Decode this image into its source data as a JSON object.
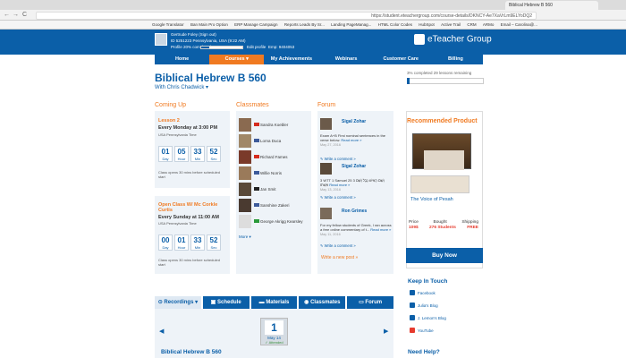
{
  "browser": {
    "tab_title": "Biblical Hebrew B 560",
    "url": "https://student.eteachergroup.com/course-details/DKNCY-Ae7XaVrLm9ELYoDQ2",
    "nav_back": "←",
    "nav_forward": "→",
    "nav_reload": "C",
    "bookmarks": [
      "Google Translator",
      "Ban Main Pro Option",
      "ERP Manage Campaign",
      "Reports Leads By Sr...",
      "Landing PageManag...",
      "HTML Color Codes",
      "HubSpot",
      "Active Trail",
      "CRM",
      "ARMo",
      "Email – Carolina@..."
    ]
  },
  "user": {
    "name": "Gertrude Foley",
    "sign_out": "(Sign out)",
    "id_line": "ID 5251223    Pennsylvania, USA (9:22 AM)",
    "profile_line": "Profile 20% completed",
    "edit_profile": "Edit profile",
    "emp_line": "Emp: 9404053",
    "profile_percent": 20
  },
  "logo": "eTeacher Group",
  "nav": [
    "Home",
    "Courses ▾",
    "My Achievements",
    "Webinars",
    "Customer Care",
    "Billing"
  ],
  "course": {
    "title": "Biblical Hebrew B 560",
    "subtitle": "With Chris Chadwick ▾",
    "completion_text": "3% completed    29 lessons remaining",
    "completion_percent": 3
  },
  "coming_up": {
    "heading": "Coming Up",
    "lessons": [
      {
        "name": "Lesson 2",
        "time": "Every Monday at 3:00 PM",
        "tz": "USA Pennsylvania Time",
        "countdown": [
          "01",
          "05",
          "33",
          "52"
        ],
        "units": [
          "Day",
          "Hour",
          "Min",
          "Sec"
        ],
        "note": "Class opens 30 mins before scheduled start"
      },
      {
        "name": "Open Class W/ Mc Corkle Curtis",
        "time": "Every Sunday at 11:00 AM",
        "tz": "USA Pennsylvania Time",
        "countdown": [
          "00",
          "01",
          "33",
          "52"
        ],
        "units": [
          "Day",
          "Hour",
          "Min",
          "Sec"
        ],
        "note": "Class opens 30 mins before scheduled start"
      }
    ]
  },
  "classmates": {
    "heading": "Classmates",
    "items": [
      {
        "name": "Sandra Koebler",
        "flag": "ca"
      },
      {
        "name": "Lorna Duca",
        "flag": "us"
      },
      {
        "name": "Richard Fames",
        "flag": "ca"
      },
      {
        "name": "Willie Norris",
        "flag": "us"
      },
      {
        "name": "Jan Smit",
        "flag": "de"
      },
      {
        "name": "Sanshine Zakeri",
        "flag": "us"
      },
      {
        "name": "George Akrigg Kearsley",
        "flag": "br"
      }
    ],
    "more": "More ▾"
  },
  "forum": {
    "heading": "Forum",
    "posts": [
      {
        "name": "Sigal Zohar",
        "text": "Exam A+B First nominal sentences in the verse below.",
        "more": "Read more »",
        "date": "May 27, 2016",
        "write": "✎ Write a comment »"
      },
      {
        "name": "Sigal Zohar",
        "text": "3 WTT 1 Samuel 25 3 וְשֵׁם הָאִישׁ נָבָל וְשֵׁם אִשְׁתּוֹ",
        "more": "Read more »",
        "date": "May 13, 2016",
        "write": "✎ Write a comment »"
      },
      {
        "name": "Ron Grimes",
        "text": "For my fellow students of Greek, I ran across a free online commentary of t...",
        "more": "Read more »",
        "date": "May 11, 2016",
        "write": "✎ Write a comment »"
      }
    ],
    "write_post": "Write a new post »"
  },
  "recommended": {
    "heading": "Recommended Product",
    "product_name": "The Voice of Pesah",
    "labels": [
      "Price",
      "Bought",
      "Shipping"
    ],
    "values": [
      "109$",
      "276 Students",
      "FREE"
    ],
    "buy": "Buy Now"
  },
  "keep_in_touch": {
    "heading": "Keep In Touch",
    "items": [
      "Facebook",
      "Julia's Blog",
      "J. Lemon's Blog",
      "YouTube"
    ]
  },
  "need_help": "Need Help?",
  "bottom_tabs": [
    "Recordings ▾",
    "Schedule",
    "Materials",
    "Classmates",
    "Forum"
  ],
  "lesson_card": {
    "number": "1",
    "date": "May 14",
    "status": "✓ Attended"
  },
  "bottom_title": "Biblical Hebrew B 560",
  "colors": {
    "primary": "#0b5fa8",
    "accent": "#f07a21",
    "price": "#e63b2e"
  }
}
